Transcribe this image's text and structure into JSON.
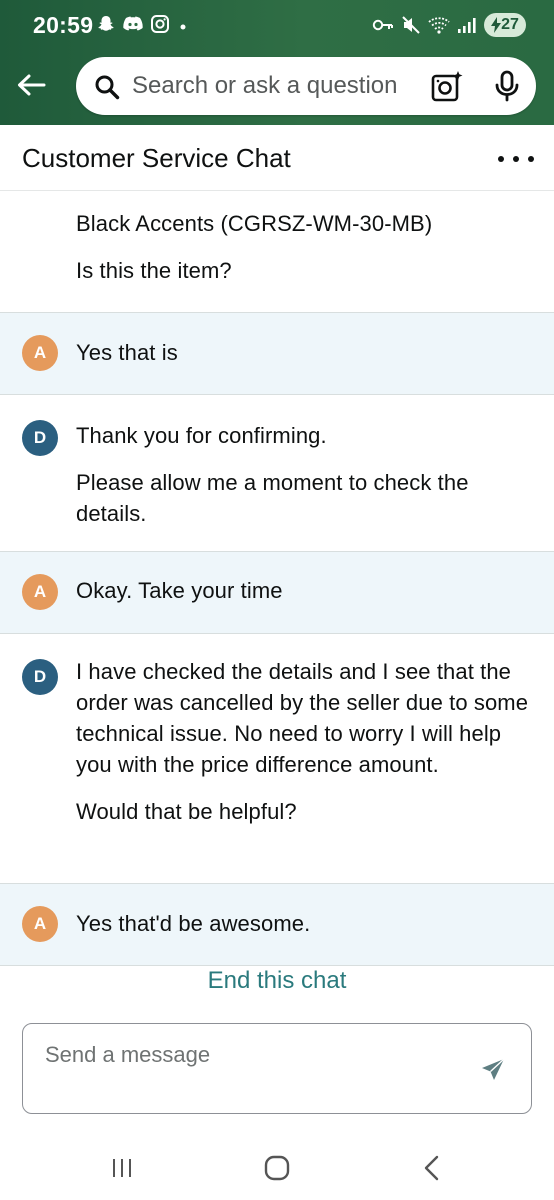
{
  "status_bar": {
    "time": "20:59",
    "battery": "27",
    "left_icons": [
      "snapchat-icon",
      "discord-icon",
      "instagram-icon",
      "dot-icon"
    ],
    "right_icons": [
      "key-icon",
      "mute-icon",
      "wifi-icon",
      "signal-icon"
    ]
  },
  "search": {
    "placeholder": "Search or ask a question"
  },
  "header": {
    "title": "Customer Service Chat"
  },
  "colors": {
    "header_green": "#2f6e45",
    "customer_bubble_bg": "#eef6fa",
    "customer_avatar": "#e59a5c",
    "agent_avatar": "#2b5f80",
    "link_teal": "#2a7a7d"
  },
  "messages": [
    {
      "sender": "agent",
      "initial": "",
      "lines": [
        "Black Accents (CGRSZ-WM-30-MB)",
        "Is this the item?"
      ]
    },
    {
      "sender": "customer",
      "initial": "A",
      "lines": [
        "Yes that is"
      ]
    },
    {
      "sender": "agent",
      "initial": "D",
      "lines": [
        "Thank you for confirming.",
        "Please allow me a moment to check the details."
      ]
    },
    {
      "sender": "customer",
      "initial": "A",
      "lines": [
        "Okay. Take your time"
      ]
    },
    {
      "sender": "agent",
      "initial": "D",
      "lines": [
        "I have checked the details and I see that the order was cancelled by the seller due to some technical issue. No need to worry I will help you with the price difference amount.",
        "Would that be helpful?"
      ]
    },
    {
      "sender": "customer",
      "initial": "A",
      "lines": [
        "Yes that'd be awesome."
      ]
    }
  ],
  "footer": {
    "end_chat": "End this chat",
    "composer_placeholder": "Send a message"
  }
}
